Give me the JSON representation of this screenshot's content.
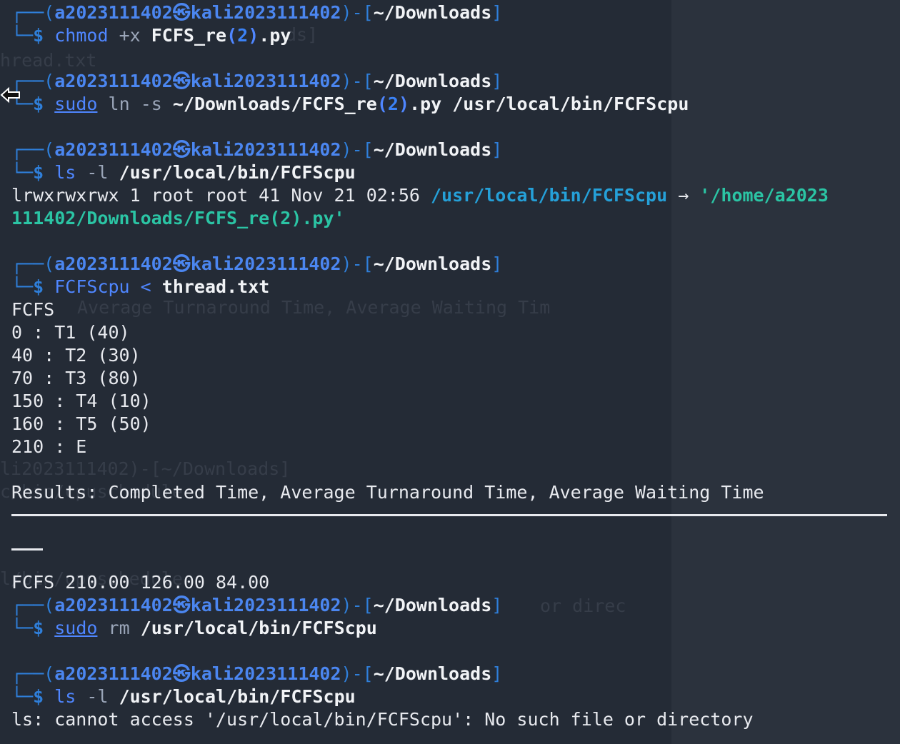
{
  "prompt": {
    "user": "a2023111402",
    "at_symbol": "㉿",
    "host": "kali2023111402",
    "cwd": "~/Downloads",
    "dollar": "$"
  },
  "blocks": [
    {
      "cmd": "chmod",
      "args": [
        "+x",
        "FCFS_re(2).py"
      ]
    },
    {
      "cmd": "sudo",
      "args": [
        "ln",
        "-s",
        "~/Downloads/FCFS_re(2).py",
        "/usr/local/bin/FCFScpu"
      ]
    },
    {
      "cmd": "ls",
      "args": [
        "-l",
        "/usr/local/bin/FCFScpu"
      ]
    },
    {
      "cmd": "FCFScpu",
      "args": [
        "<",
        "thread.txt"
      ]
    },
    {
      "cmd": "sudo",
      "args": [
        "rm",
        "/usr/local/bin/FCFScpu"
      ]
    },
    {
      "cmd": "ls",
      "args": [
        "-l",
        "/usr/local/bin/FCFScpu"
      ]
    }
  ],
  "ls_output": {
    "perm": "lrwxrwxrwx 1 root root 41 Nov 21 02:56 ",
    "link": "/usr/local/bin/FCFScpu",
    "arrow": " → ",
    "target_1": "'/home/a2023",
    "target_2": "111402/Downloads/FCFS_re(2).py'"
  },
  "fcfs_output": {
    "title": "FCFS",
    "rows": [
      "0 : T1 (40)",
      "40 : T2 (30)",
      "70 : T3 (80)",
      "150 : T4 (10)",
      "160 : T5 (50)",
      "210 : E"
    ],
    "results_header": "Results: Completed Time, Average Turnaround Time, Average Waiting Time",
    "results_row": "FCFS 210.00 126.00 84.00"
  },
  "error_output": "ls: cannot access '/usr/local/bin/FCFScpu': No such file or directory",
  "ghost_text": {
    "g1": "ds]",
    "g2": "hread.txt",
    "g3": "Average Turnaround Time, Average Waiting Tim",
    "g4": "li2023111402)-[~/Downloads]",
    "g5": "c/bin/cpuschedule",
    "g6": "l/bin/cpuschedule",
    "g7": "or direc"
  }
}
